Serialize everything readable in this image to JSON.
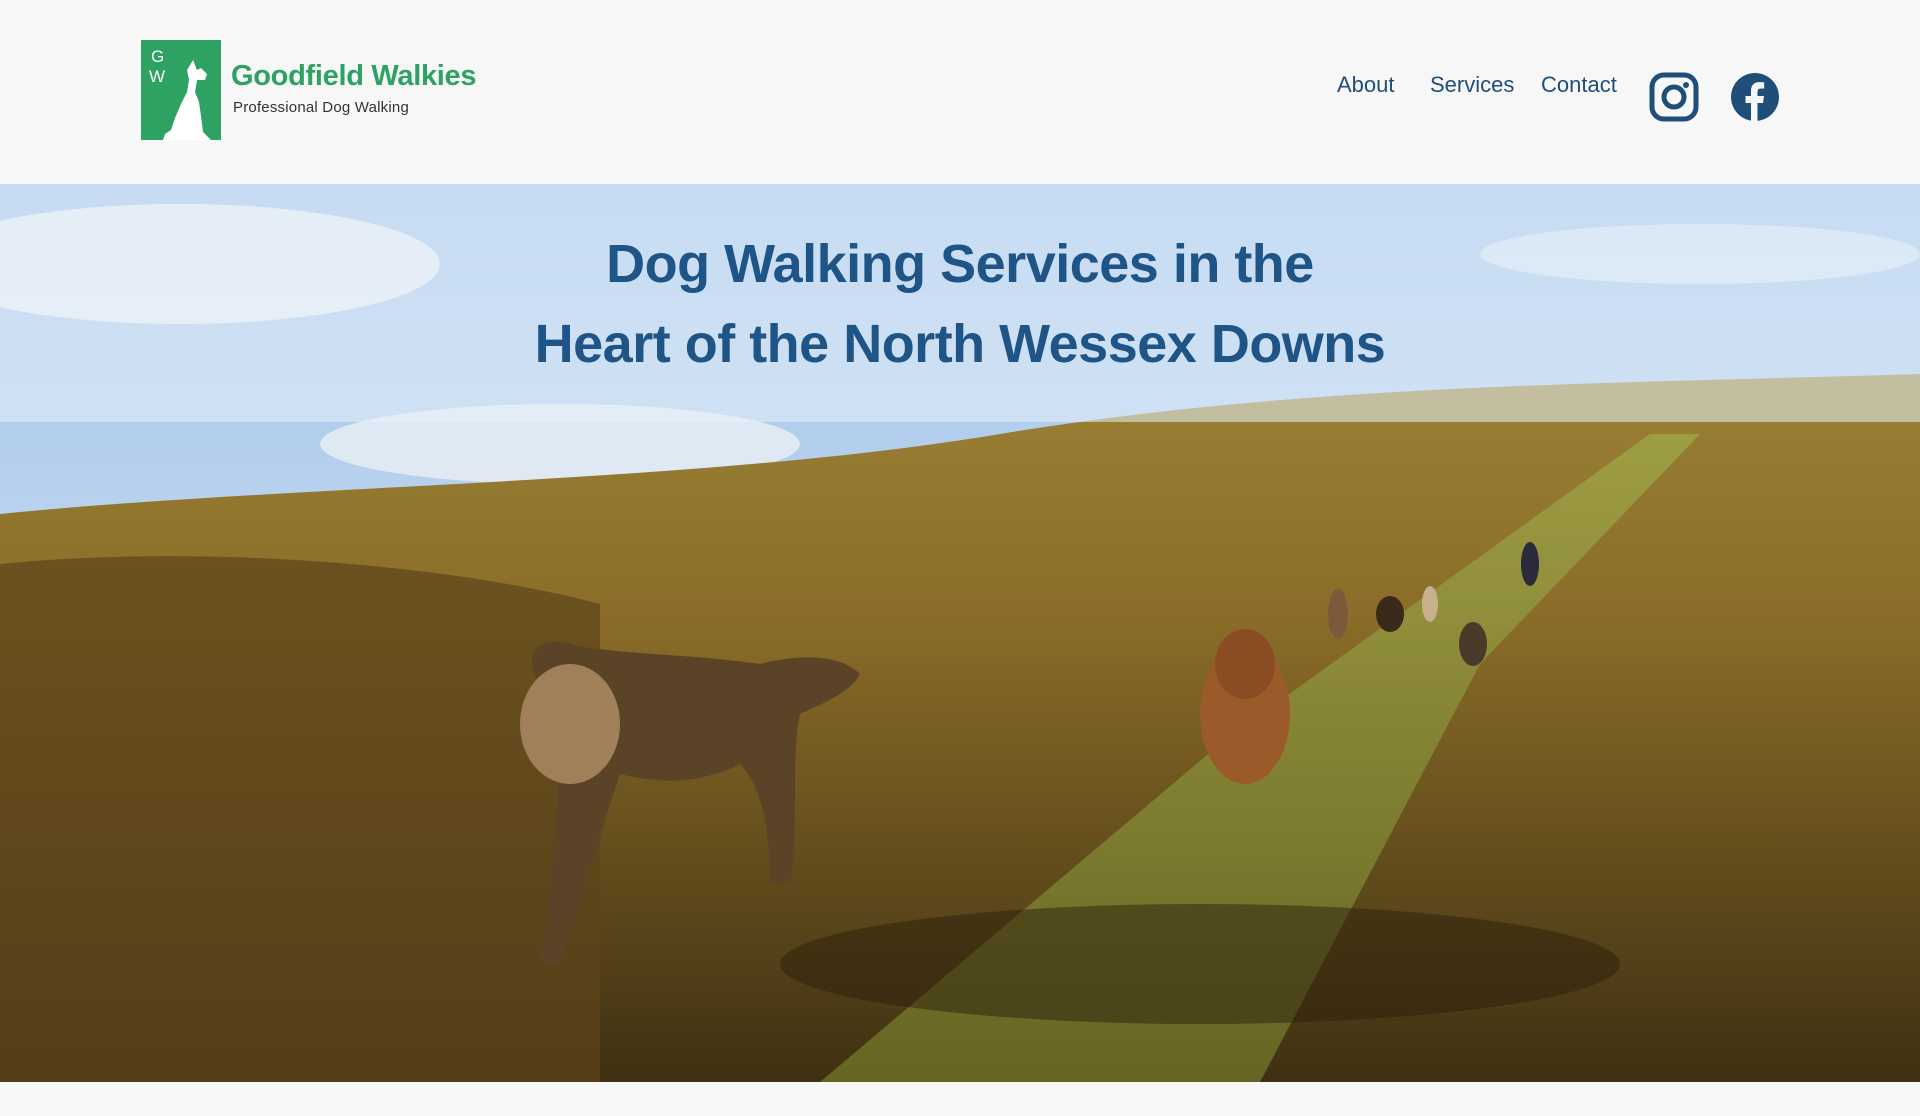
{
  "brand": {
    "monogram": "GW",
    "name": "Goodfield Walkies",
    "tagline": "Professional Dog Walking"
  },
  "nav": {
    "items": [
      {
        "label": "About"
      },
      {
        "label": "Services"
      },
      {
        "label": "Contact"
      }
    ],
    "social": [
      {
        "icon": "instagram-icon"
      },
      {
        "icon": "facebook-icon"
      }
    ]
  },
  "hero": {
    "title_line1": "Dog Walking Services in the",
    "title_line2": "Heart of the North Wessex Downs"
  },
  "colors": {
    "brand_green": "#2ea262",
    "navy": "#1f4e79",
    "title_blue": "#1f5487",
    "page_bg": "#f7f7f7"
  }
}
